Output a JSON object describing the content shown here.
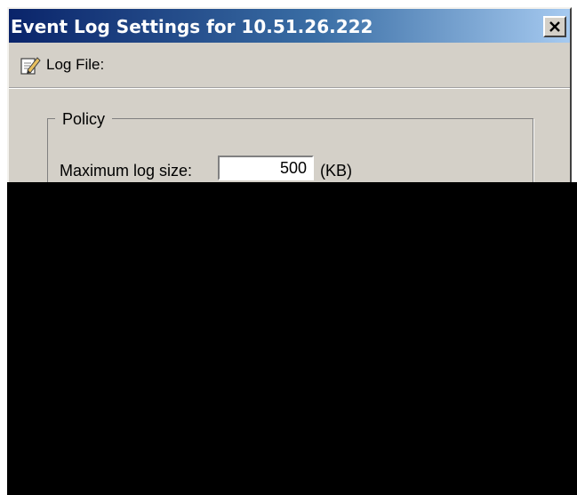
{
  "window": {
    "title": "Event Log Settings for 10.51.26.222"
  },
  "toolbar": {
    "log_file_label": "Log File:",
    "log_file_icon": "edit-document-icon"
  },
  "policy": {
    "group_label": "Policy",
    "max_log_size_label": "Maximum log size:",
    "max_log_size_value": "500",
    "max_log_size_unit": "(KB)"
  },
  "icons": {
    "close": "close-icon"
  },
  "colors": {
    "title_bar_start": "#0a246a",
    "title_bar_end": "#a6caf0",
    "dialog_bg": "#d4d0c8",
    "redacted_region": "#000000"
  }
}
